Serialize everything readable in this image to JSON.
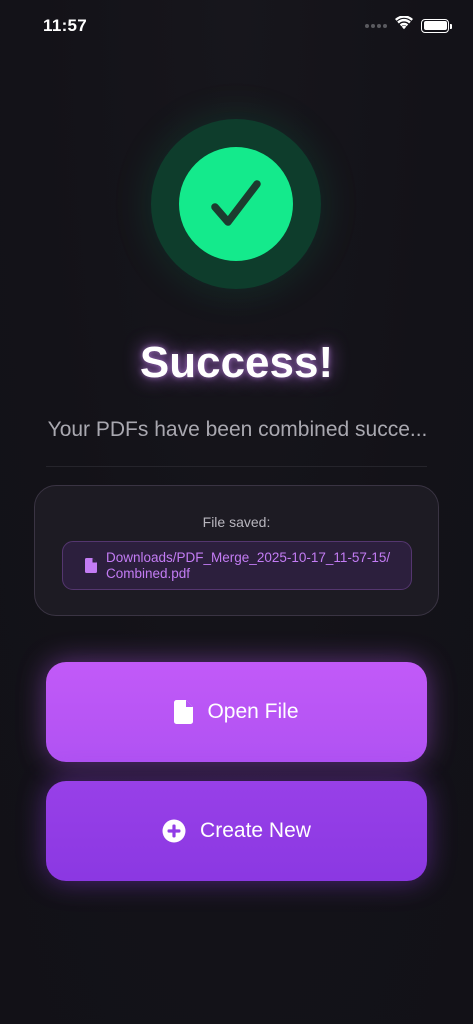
{
  "status_bar": {
    "time": "11:57",
    "icons": [
      "signal-dots-icon",
      "wifi-icon",
      "battery-icon"
    ]
  },
  "success": {
    "icon": "checkmark-icon",
    "title": "Success!",
    "subtitle": "Your PDFs have been combined succe..."
  },
  "file_card": {
    "label": "File saved:",
    "icon": "document-icon",
    "path": "Downloads/PDF_Merge_2025-10-17_11-57-15/\nCombined.pdf"
  },
  "buttons": {
    "open_file": {
      "label": "Open File",
      "icon": "document-icon"
    },
    "create_new": {
      "label": "Create New",
      "icon": "plus-circle-icon"
    }
  },
  "colors": {
    "background": "#131218",
    "success_green": "#14ea8c",
    "success_ring": "#0e3d2c",
    "accent_purple_light": "#c25af8",
    "accent_purple": "#9840e8",
    "path_text": "#c37cf4"
  }
}
